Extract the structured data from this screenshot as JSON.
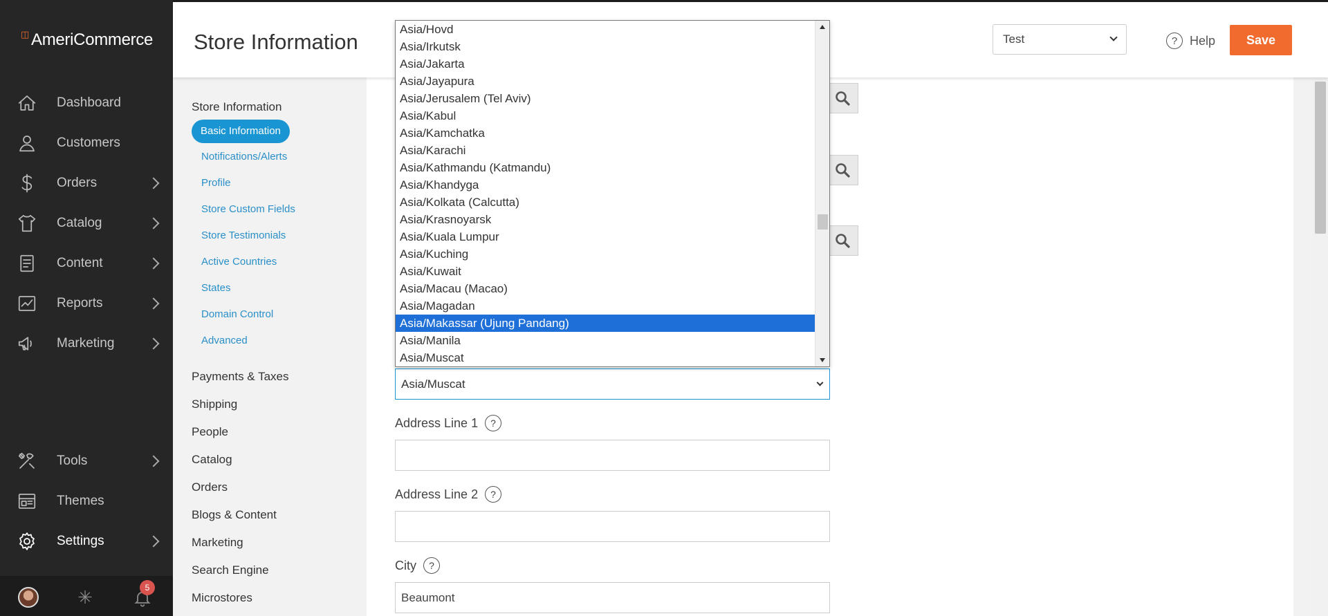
{
  "app": {
    "brand": "AmeriCommerce"
  },
  "sidebar": {
    "items": [
      {
        "label": "Dashboard",
        "icon": "home-icon",
        "has_arrow": false
      },
      {
        "label": "Customers",
        "icon": "user-icon",
        "has_arrow": false
      },
      {
        "label": "Orders",
        "icon": "dollar-icon",
        "has_arrow": true
      },
      {
        "label": "Catalog",
        "icon": "shirt-icon",
        "has_arrow": true
      },
      {
        "label": "Content",
        "icon": "document-icon",
        "has_arrow": true
      },
      {
        "label": "Reports",
        "icon": "chart-icon",
        "has_arrow": true
      },
      {
        "label": "Marketing",
        "icon": "megaphone-icon",
        "has_arrow": true
      }
    ],
    "tools": [
      {
        "label": "Tools",
        "icon": "tools-icon",
        "has_arrow": true
      },
      {
        "label": "Themes",
        "icon": "themes-icon",
        "has_arrow": false
      },
      {
        "label": "Settings",
        "icon": "gear-icon",
        "has_arrow": true,
        "active": true
      }
    ],
    "footer": {
      "notification_count": "5"
    }
  },
  "header": {
    "title": "Store Information",
    "store_select": "Test",
    "help_label": "Help",
    "save_label": "Save"
  },
  "subnav": {
    "section": "Store Information",
    "links": [
      {
        "label": "Basic Information",
        "active": true
      },
      {
        "label": "Notifications/Alerts"
      },
      {
        "label": "Profile"
      },
      {
        "label": "Store Custom Fields"
      },
      {
        "label": "Store Testimonials"
      },
      {
        "label": "Active Countries"
      },
      {
        "label": "States"
      },
      {
        "label": "Domain Control"
      },
      {
        "label": "Advanced"
      }
    ],
    "sections": [
      "Payments & Taxes",
      "Shipping",
      "People",
      "Catalog",
      "Orders",
      "Blogs & Content",
      "Marketing",
      "Search Engine",
      "Microstores"
    ]
  },
  "form": {
    "timezone_value": "Asia/Muscat",
    "address1_label": "Address Line 1",
    "address1_value": "",
    "address2_label": "Address Line 2",
    "address2_value": "",
    "city_label": "City",
    "city_value": "Beaumont"
  },
  "dropdown": {
    "options": [
      "Asia/Hovd",
      "Asia/Irkutsk",
      "Asia/Jakarta",
      "Asia/Jayapura",
      "Asia/Jerusalem (Tel Aviv)",
      "Asia/Kabul",
      "Asia/Kamchatka",
      "Asia/Karachi",
      "Asia/Kathmandu (Katmandu)",
      "Asia/Khandyga",
      "Asia/Kolkata (Calcutta)",
      "Asia/Krasnoyarsk",
      "Asia/Kuala Lumpur",
      "Asia/Kuching",
      "Asia/Kuwait",
      "Asia/Macau (Macao)",
      "Asia/Magadan",
      "Asia/Makassar (Ujung Pandang)",
      "Asia/Manila",
      "Asia/Muscat"
    ],
    "highlighted": "Asia/Makassar (Ujung Pandang)"
  }
}
